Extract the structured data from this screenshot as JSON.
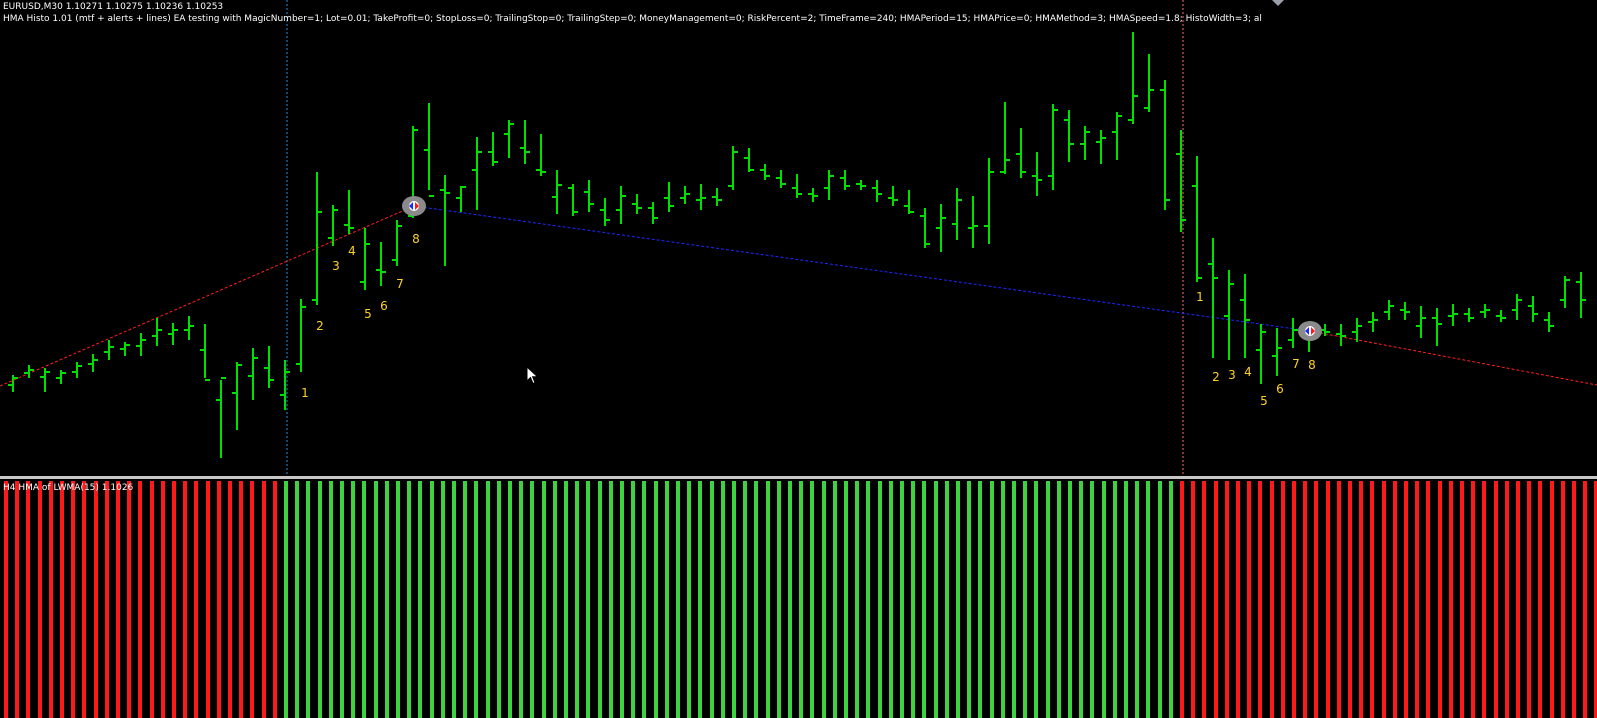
{
  "main_chart": {
    "symbol_line": "EURUSD,M30  1.10271 1.10275 1.10236 1.10253",
    "ea_line": "HMA Histo 1.01 (mtf + alerts + lines) EA testing with MagicNumber=1; Lot=0.01; TakeProfit=0; StopLoss=0; TrailingStop=0; TrailingStep=0; MoneyManagement=0; RiskPercent=2; TimeFrame=240; HMAPeriod=15; HMAPrice=0; HMAMethod=3; HMASpeed=1.8; HistoWidth=3; al",
    "bar_color": "#00e000",
    "count_labels_first": [
      "1",
      "2",
      "3",
      "4",
      "5",
      "6",
      "7",
      "8"
    ],
    "count_labels_second": [
      "1",
      "2",
      "3",
      "4",
      "5",
      "6",
      "7",
      "8"
    ],
    "label_color": "#ffd21e",
    "line_up_color": "#ff2020",
    "line_down_color": "#1e28ff"
  },
  "indicator": {
    "label": "H4 HMA of LWMA(15) 1.1026",
    "up_color": "#3fd23f",
    "down_color": "#ff1a1a"
  }
}
